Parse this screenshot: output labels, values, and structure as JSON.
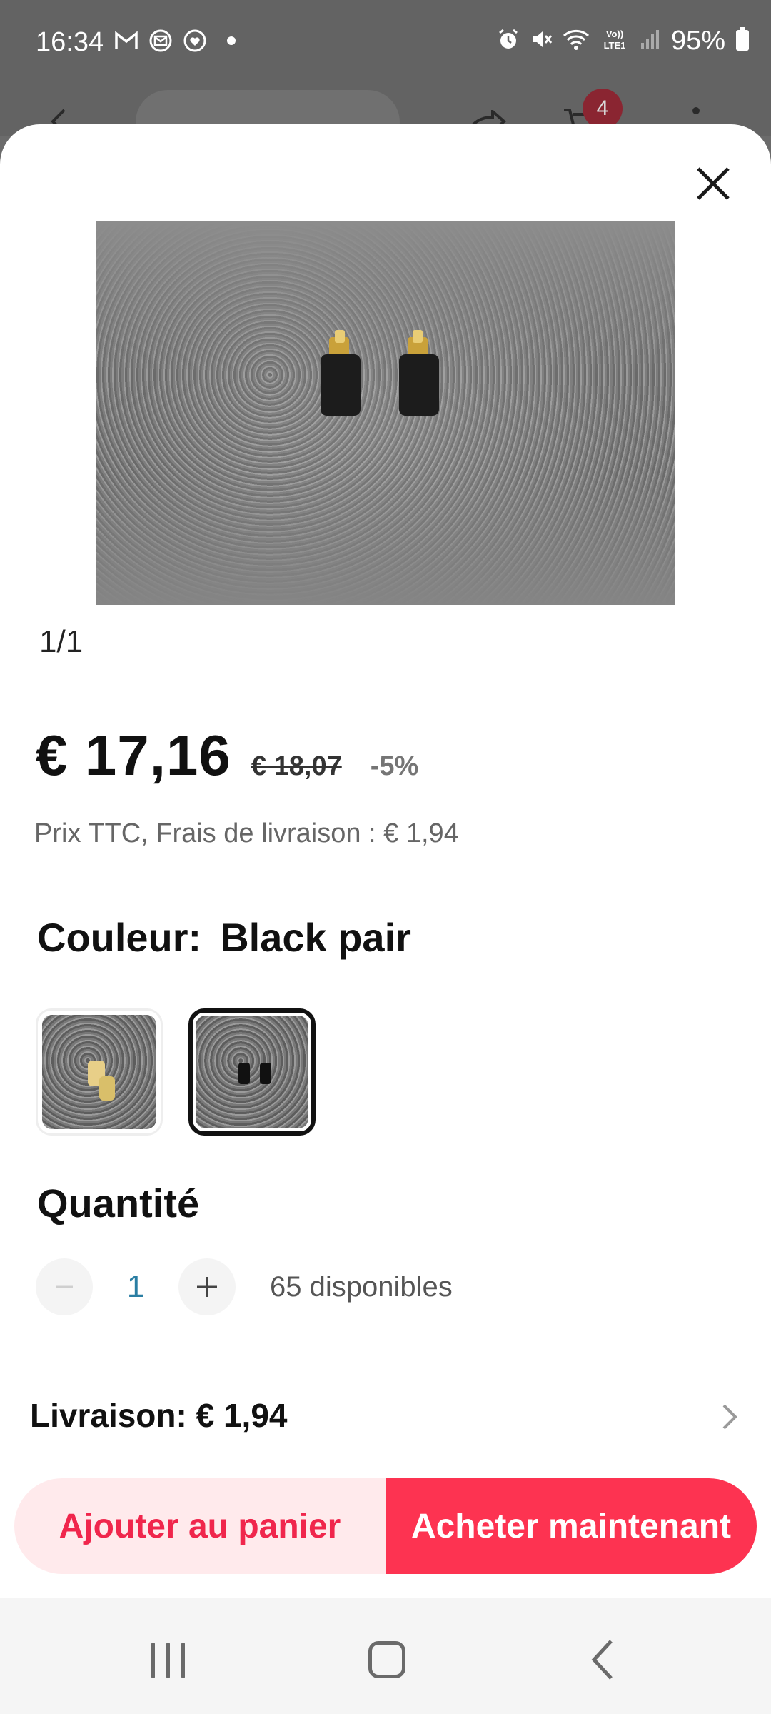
{
  "status_bar": {
    "time": "16:34",
    "battery": "95%",
    "left_icons": [
      "gmail-icon",
      "mail-icon",
      "heart-app-icon",
      "dot-icon"
    ],
    "right_icons": [
      "alarm-icon",
      "mute-icon",
      "wifi-icon",
      "volte-icon",
      "signal-icon",
      "battery-icon"
    ]
  },
  "background_page": {
    "cart_badge": "4"
  },
  "product": {
    "image_counter": "1/1",
    "price_current": "€ 17,16",
    "price_original": "€ 18,07",
    "discount": "-5%",
    "price_info": "Prix TTC, Frais de livraison : € 1,94"
  },
  "color": {
    "label": "Couleur:",
    "selected": "Black pair",
    "options_count_visible": 2,
    "selected_index": 1
  },
  "quantity": {
    "title": "Quantité",
    "value": "1",
    "available": "65 disponibles"
  },
  "shipping": {
    "label": "Livraison: € 1,94"
  },
  "actions": {
    "add_to_cart": "Ajouter au panier",
    "buy_now": "Acheter maintenant"
  },
  "colors": {
    "accent": "#fd3351",
    "accent_light": "#ffeaec",
    "quantity_value": "#2a7ea3"
  }
}
